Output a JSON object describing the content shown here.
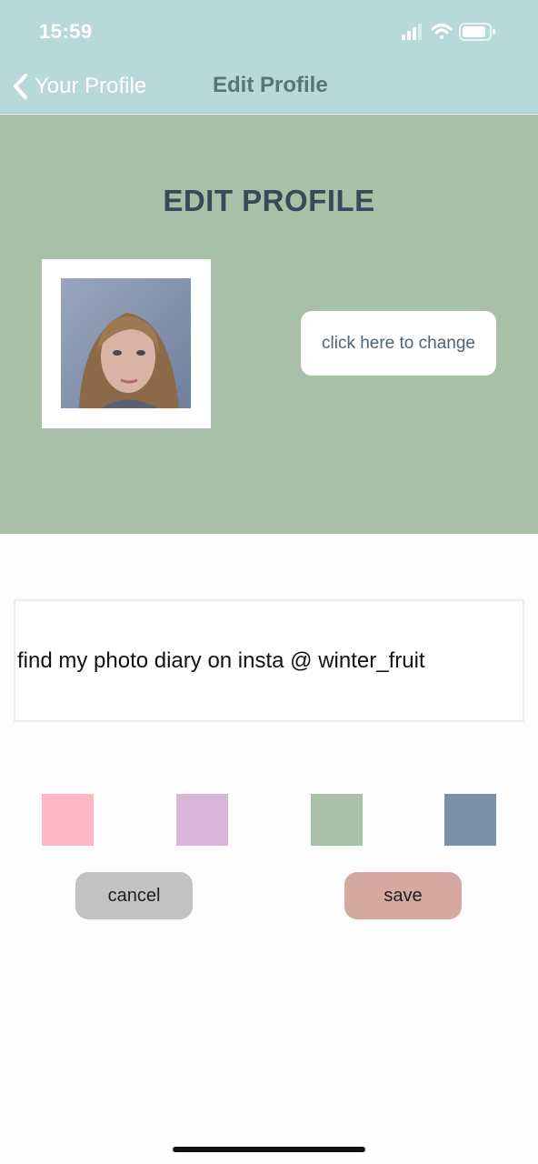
{
  "status_bar": {
    "time": "15:59",
    "icons": [
      "cellular-signal-icon",
      "wifi-icon",
      "battery-icon"
    ]
  },
  "nav": {
    "back_label": "Your Profile",
    "title": "Edit Profile",
    "back_icon": "chevron-left-icon"
  },
  "header": {
    "title": "EDIT PROFILE",
    "change_photo_label": "click here to change"
  },
  "bio": {
    "value": "find my photo diary on insta @ winter_fruit"
  },
  "swatches": [
    {
      "name": "pink",
      "color": "#ffb8c3"
    },
    {
      "name": "lilac",
      "color": "#d9b6d8"
    },
    {
      "name": "sage",
      "color": "#a8c0a8"
    },
    {
      "name": "slate-blue",
      "color": "#7a91aa"
    }
  ],
  "actions": {
    "cancel_label": "cancel",
    "save_label": "save"
  },
  "colors": {
    "topbar": "#b7d9d9",
    "hero": "#a8c0a8",
    "cancel": "#c2c2c2",
    "save": "#d5a9a1"
  }
}
